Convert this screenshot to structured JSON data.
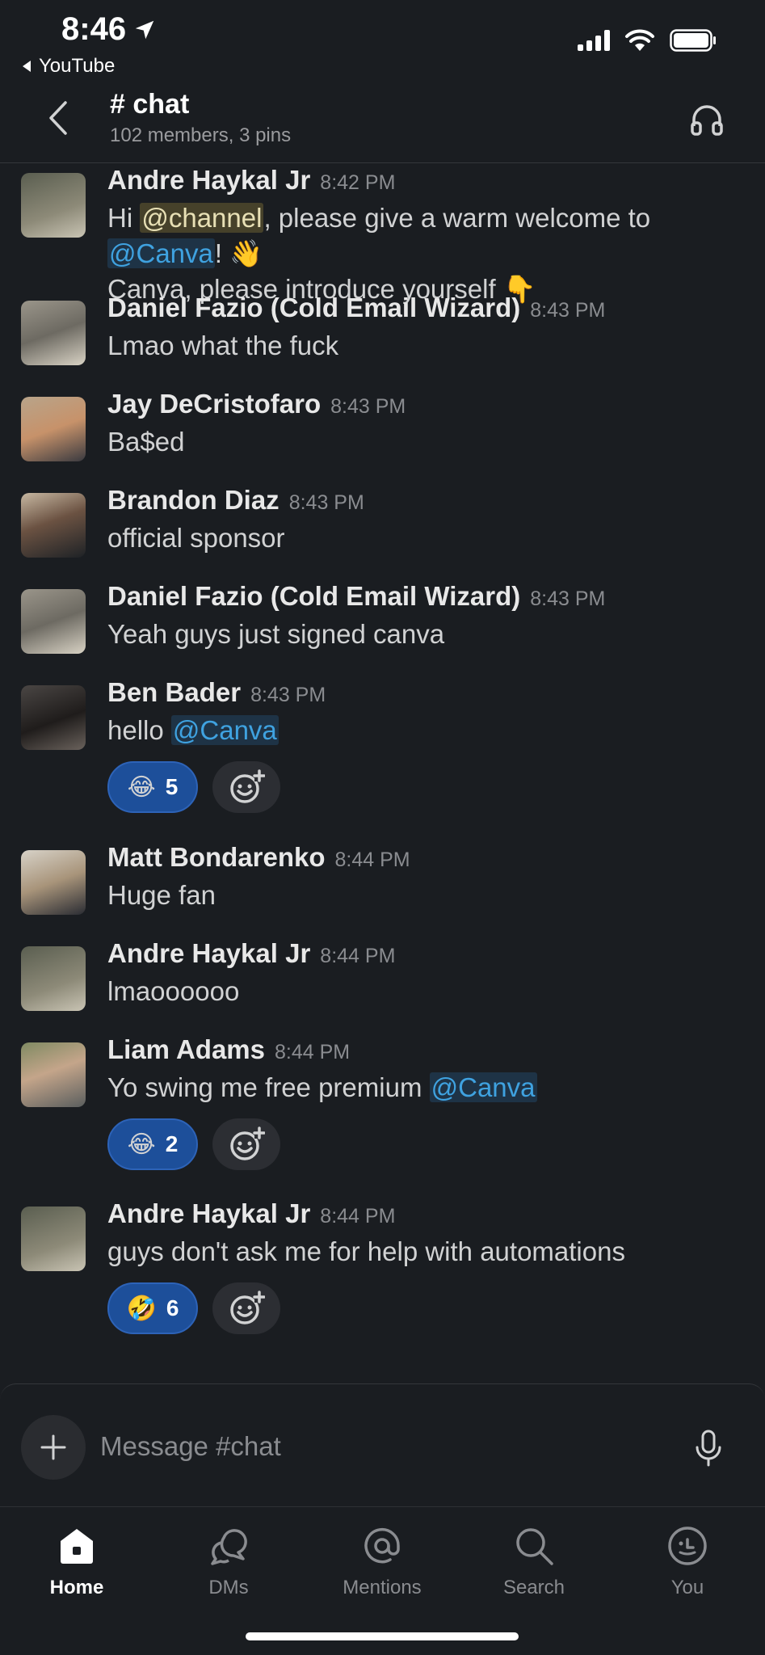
{
  "status_bar": {
    "time": "8:46",
    "back_app": "YouTube"
  },
  "header": {
    "title": "# chat",
    "subtitle": "102 members, 3 pins"
  },
  "messages": [
    {
      "author": "Andre Haykal Jr",
      "time": "8:42 PM",
      "line1_pre": "Hi ",
      "line1_channel_mention": "@channel",
      "line1_post": ", please give a warm welcome to",
      "line2_user_mention": "@Canva",
      "line2_post": "! 👋",
      "line3": "Canva, please introduce yourself 👇",
      "avatar_color": "#6b6f5e"
    },
    {
      "author": "Daniel Fazio (Cold Email Wizard)",
      "time": "8:43 PM",
      "text": "Lmao what the fuck",
      "avatar_color": "#7a7870"
    },
    {
      "author": "Jay DeCristofaro",
      "time": "8:43 PM",
      "text": "Ba$ed",
      "avatar_color": "#8a7560"
    },
    {
      "author": "Brandon Diaz",
      "time": "8:43 PM",
      "text": "official sponsor",
      "avatar_color": "#3d3b3a"
    },
    {
      "author": "Daniel Fazio (Cold Email Wizard)",
      "time": "8:43 PM",
      "text": "Yeah guys just signed canva",
      "avatar_color": "#7a7870"
    },
    {
      "author": "Ben Bader",
      "time": "8:43 PM",
      "text_pre": "hello ",
      "user_mention": "@Canva",
      "reaction": {
        "emoji": "😂",
        "count": "5"
      },
      "avatar_color": "#2e2b2a"
    },
    {
      "author": "Matt Bondarenko",
      "time": "8:44 PM",
      "text": "Huge fan",
      "avatar_color": "#9a8c80"
    },
    {
      "author": "Andre Haykal Jr",
      "time": "8:44 PM",
      "text": "lmaoooooo",
      "avatar_color": "#6b6f5e"
    },
    {
      "author": "Liam Adams",
      "time": "8:44 PM",
      "text_pre": "Yo swing me free premium ",
      "user_mention": "@Canva",
      "reaction": {
        "emoji": "😂",
        "count": "2"
      },
      "avatar_color": "#6e7a5a"
    },
    {
      "author": "Andre Haykal Jr",
      "time": "8:44 PM",
      "text": "guys don't ask me for help with automations",
      "reaction": {
        "emoji": "🤣",
        "count": "6"
      },
      "avatar_color": "#6b6f5e"
    }
  ],
  "composer": {
    "placeholder": "Message #chat"
  },
  "tabs": [
    {
      "label": "Home",
      "active": true
    },
    {
      "label": "DMs"
    },
    {
      "label": "Mentions"
    },
    {
      "label": "Search"
    },
    {
      "label": "You"
    }
  ],
  "colors": {
    "background": "#1a1d21",
    "reaction_bg": "#1d4f9a",
    "mention_user": "#3fa2e0",
    "mention_channel_bg": "#46412a"
  }
}
